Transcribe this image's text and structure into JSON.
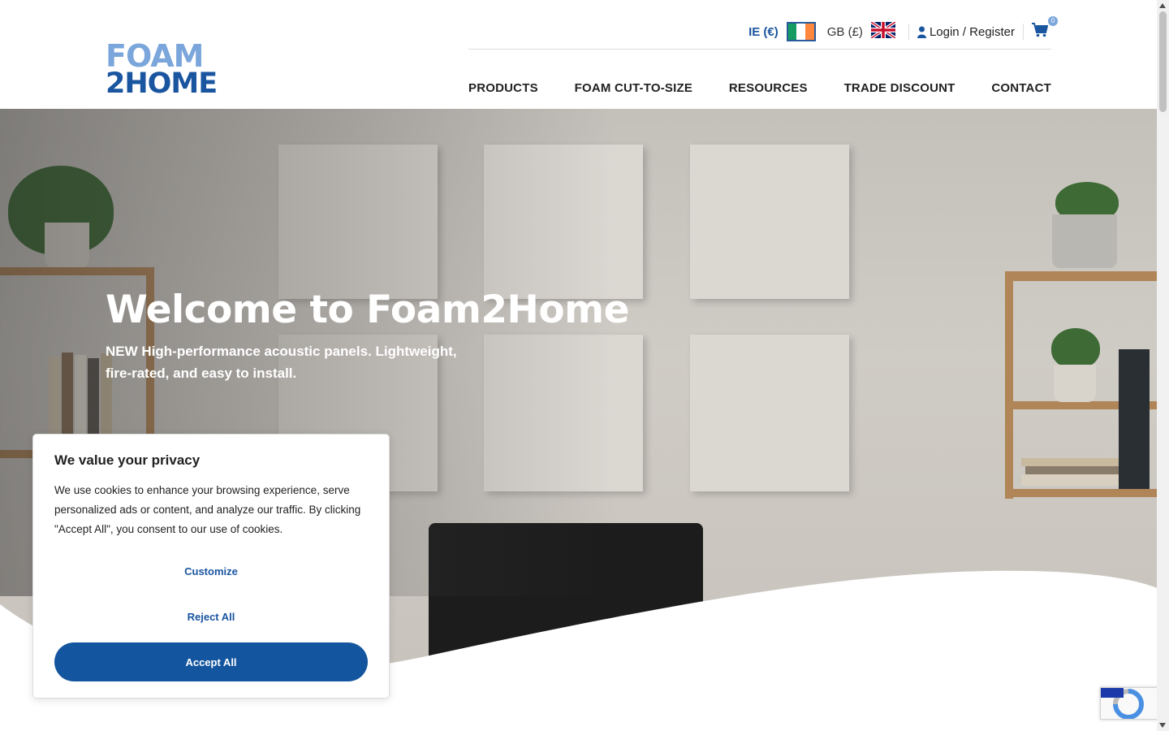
{
  "brand": {
    "line1": "FOAM",
    "line2": "2HOME"
  },
  "topbar": {
    "currency_ie": "IE (€)",
    "currency_gb": "GB (£)",
    "login": "Login / Register",
    "cart_count": "0"
  },
  "nav": {
    "items": [
      {
        "label": "PRODUCTS"
      },
      {
        "label": "FOAM CUT-TO-SIZE"
      },
      {
        "label": "RESOURCES"
      },
      {
        "label": "TRADE DISCOUNT"
      },
      {
        "label": "CONTACT"
      }
    ]
  },
  "hero": {
    "title": "Welcome to Foam2Home",
    "subtitle": "NEW High-performance acoustic panels. Lightweight, fire-rated, and easy to install."
  },
  "cookie": {
    "title": "We value your privacy",
    "body": "We use cookies to enhance your browsing experience, serve personalized ads or content, and analyze our traffic. By clicking \"Accept All\", you consent to our use of cookies.",
    "customize": "Customize",
    "reject": "Reject All",
    "accept": "Accept All"
  },
  "colors": {
    "brand_blue": "#1a55a0",
    "brand_light_blue": "#7aa6db",
    "accept_button": "#14559f"
  }
}
